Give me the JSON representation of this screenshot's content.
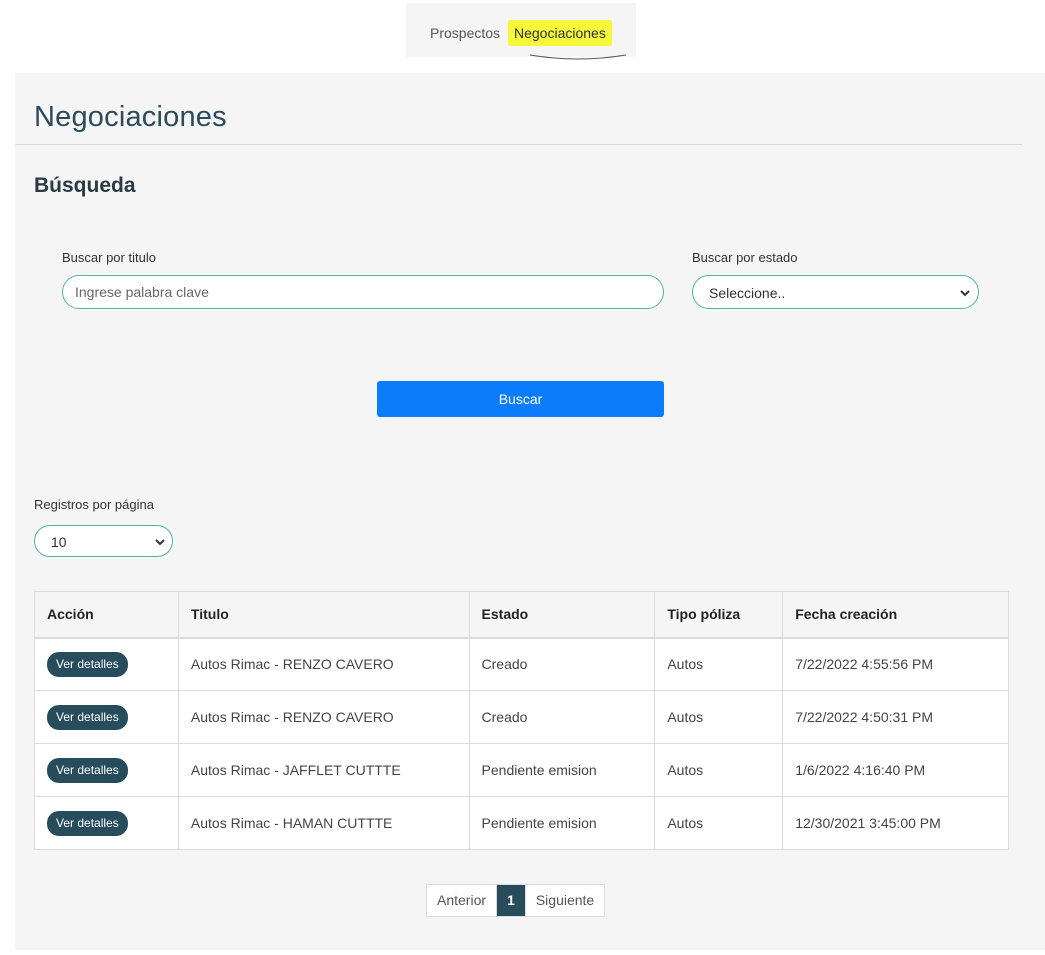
{
  "nav": {
    "tabs": [
      {
        "label": "Prospectos"
      },
      {
        "label": "Negociaciones",
        "active": true
      }
    ]
  },
  "page": {
    "title": "Negociaciones",
    "section_title": "Búsqueda"
  },
  "search": {
    "title_label": "Buscar por titulo",
    "title_placeholder": "Ingrese palabra clave",
    "state_label": "Buscar por estado",
    "state_selected": "Seleccione..",
    "button_label": "Buscar"
  },
  "paging": {
    "per_page_label": "Registros por página",
    "per_page_value": "10",
    "prev_label": "Anterior",
    "current_page": "1",
    "next_label": "Siguiente"
  },
  "table": {
    "headers": [
      "Acción",
      "Titulo",
      "Estado",
      "Tipo póliza",
      "Fecha creación"
    ],
    "action_label": "Ver detalles",
    "rows": [
      {
        "titulo": "Autos Rimac - RENZO CAVERO",
        "estado": "Creado",
        "tipo": "Autos",
        "fecha": "7/22/2022 4:55:56 PM"
      },
      {
        "titulo": "Autos Rimac - RENZO CAVERO",
        "estado": "Creado",
        "tipo": "Autos",
        "fecha": "7/22/2022 4:50:31 PM"
      },
      {
        "titulo": "Autos Rimac - JAFFLET CUTTTE",
        "estado": "Pendiente emision",
        "tipo": "Autos",
        "fecha": "1/6/2022 4:16:40 PM"
      },
      {
        "titulo": "Autos Rimac - HAMAN CUTTTE",
        "estado": "Pendiente emision",
        "tipo": "Autos",
        "fecha": "12/30/2021 3:45:00 PM"
      }
    ]
  },
  "colors": {
    "accent_teal": "#4fb3a5",
    "primary_button": "#0b7dfc",
    "dark_button": "#274d5c",
    "highlight": "#f6f63a"
  },
  "icons": {
    "select_chevron": "chevron-down-icon"
  }
}
